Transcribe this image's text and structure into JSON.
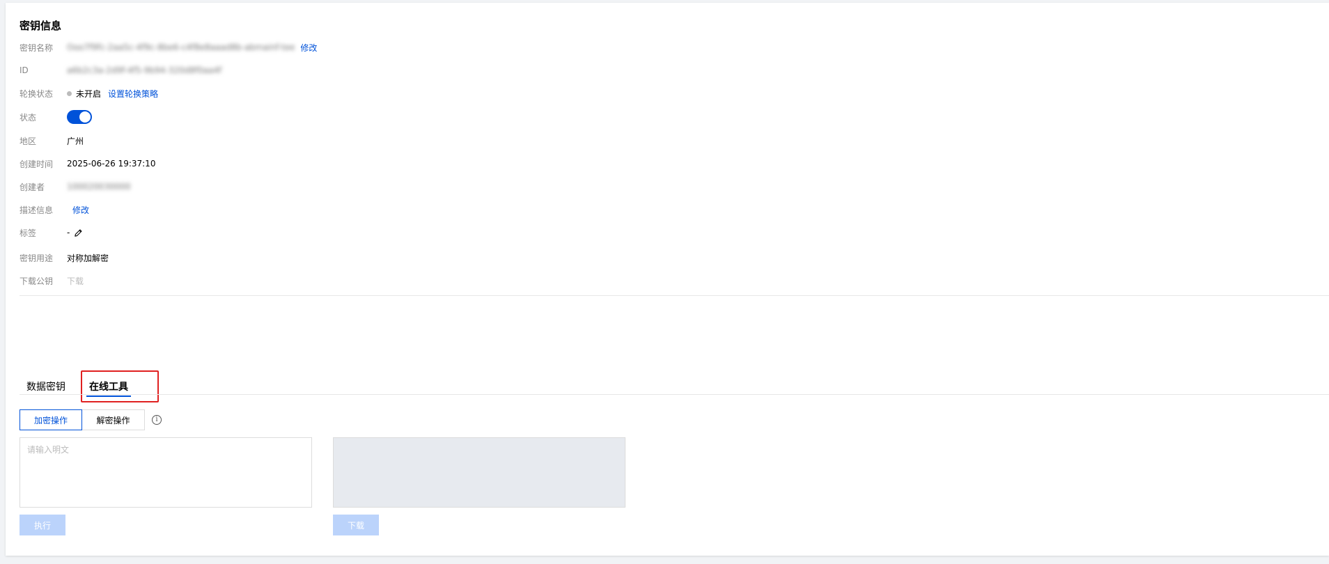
{
  "section_title": "密钥信息",
  "fields": {
    "name": {
      "label": "密钥名称",
      "value": "Ooo7f9fc-2aa5c-4f9c-8be6-c4f8e8aaad8b-abmainf-tee",
      "action": "修改"
    },
    "id": {
      "label": "ID",
      "value": "a6b2c3a-2d9f-4f5-9b94-320d8f0aa4f"
    },
    "rotation": {
      "label": "轮换状态",
      "value": "未开启",
      "action": "设置轮换策略"
    },
    "status": {
      "label": "状态",
      "enabled": true
    },
    "region": {
      "label": "地区",
      "value": "广州"
    },
    "created_at": {
      "label": "创建时间",
      "value": "2025-06-26 19:37:10"
    },
    "creator": {
      "label": "创建者",
      "value": "100020030000"
    },
    "description": {
      "label": "描述信息",
      "action": "修改"
    },
    "tags": {
      "label": "标签",
      "value": "-"
    },
    "usage": {
      "label": "密钥用途",
      "value": "对称加解密"
    },
    "public_key": {
      "label": "下载公钥",
      "action": "下载"
    }
  },
  "tabs": [
    {
      "label": "数据密钥",
      "active": false
    },
    {
      "label": "在线工具",
      "active": true
    }
  ],
  "tool": {
    "modes": [
      "加密操作",
      "解密操作"
    ],
    "active_mode": "加密操作",
    "input_placeholder": "请输入明文",
    "execute_label": "执行",
    "download_label": "下载"
  },
  "colors": {
    "primary": "#0052d9",
    "highlight": "#e02020",
    "disabled_button": "#bbd3fb"
  }
}
